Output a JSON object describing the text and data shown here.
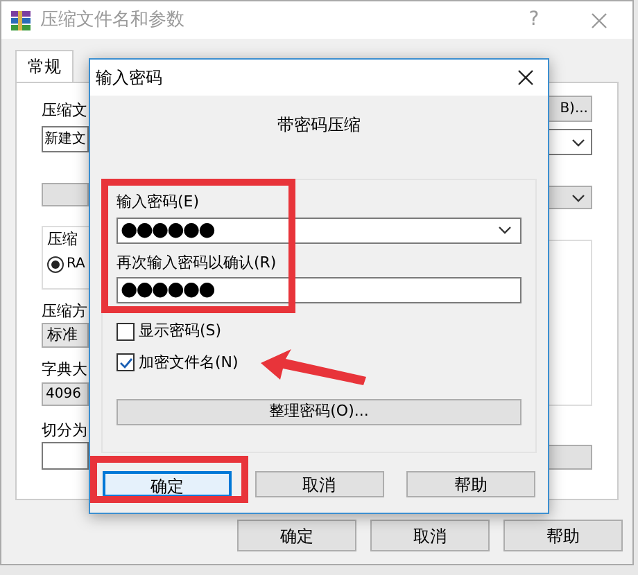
{
  "window": {
    "title": "压缩文件名和参数",
    "help": "?"
  },
  "tabs": [
    {
      "label": "常规",
      "selected": true
    }
  ],
  "general": {
    "archive_name_label": "压缩文",
    "archive_name_value": "新建文",
    "browse_button": "B)...",
    "format_group_label": "压缩",
    "format_radio": {
      "label": "RA",
      "selected": true
    },
    "method_label": "压缩方",
    "method_value": "标准",
    "dictionary_label": "字典大",
    "dictionary_value": "4096",
    "split_label": "切分为"
  },
  "buttons": [
    "确定",
    "取消",
    "帮助"
  ],
  "dialog": {
    "title": "输入密码",
    "heading": "带密码压缩",
    "password_label": "输入密码(E)",
    "password_value": "●●●●●●",
    "confirm_label": "再次输入密码以确认(R)",
    "confirm_value": "●●●●●●",
    "options": [
      {
        "label": "显示密码(S)",
        "checked": false
      },
      {
        "label": "加密文件名(N)",
        "checked": true
      }
    ],
    "organize_button": "整理密码(O)...",
    "buttons": [
      {
        "label": "确定",
        "focused": true
      },
      {
        "label": "取消",
        "focused": false
      },
      {
        "label": "帮助",
        "focused": false
      }
    ]
  }
}
